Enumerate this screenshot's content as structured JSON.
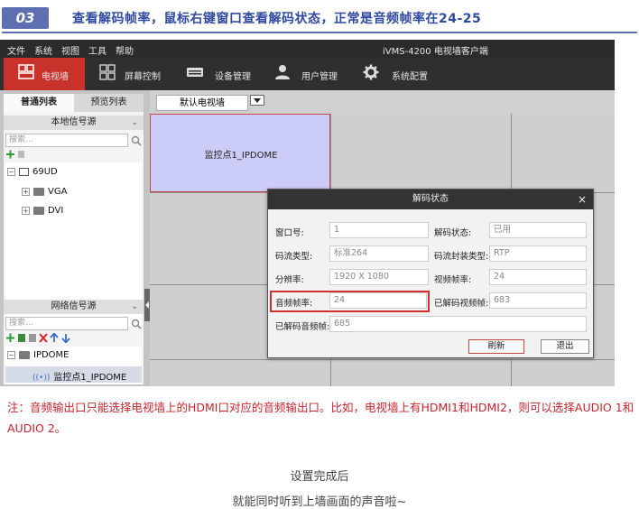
{
  "step": {
    "number": "03",
    "title": "查看解码帧率，鼠标右键窗口查看解码状态，正常是音频帧率在24-25",
    "accent": "#5d6fb0"
  },
  "app": {
    "window_title": "iVMS-4200 电视墙客户端",
    "menu": [
      "文件",
      "系统",
      "视图",
      "工具",
      "帮助"
    ],
    "toolbar": [
      {
        "label": "电视墙",
        "icon": "tv-wall-icon",
        "active": true
      },
      {
        "label": "屏幕控制",
        "icon": "screen-grid-icon",
        "active": false
      },
      {
        "label": "设备管理",
        "icon": "device-icon",
        "active": false
      },
      {
        "label": "用户管理",
        "icon": "user-icon",
        "active": false
      },
      {
        "label": "系统配置",
        "icon": "gear-icon",
        "active": false
      }
    ],
    "active_color": "#c8322b"
  },
  "left_panel": {
    "tabs": [
      "普通列表",
      "预览列表"
    ],
    "local_section": "本地信号源",
    "local_search_placeholder": "搜索...",
    "local_tree": [
      {
        "label": "69UD",
        "level": 0
      },
      {
        "label": "VGA",
        "level": 1
      },
      {
        "label": "DVI",
        "level": 1
      }
    ],
    "network_section": "网络信号源",
    "network_search_placeholder": "搜索...",
    "network_tree": [
      {
        "label": "IPDOME",
        "level": 0
      },
      {
        "label": "监控点1_IPDOME",
        "level": 1
      }
    ]
  },
  "wall": {
    "selected_wall": "默认电视墙",
    "selected_cell_label": "监控点1_IPDOME"
  },
  "dialog": {
    "title": "解码状态",
    "fields": {
      "window_no_label": "窗口号:",
      "window_no": "1",
      "decode_status_label": "解码状态:",
      "decode_status": "已用",
      "stream_type_label": "码流类型:",
      "stream_type": "标准264",
      "encap_type_label": "码流封装类型:",
      "encap_type": "RTP",
      "resolution_label": "分辨率:",
      "resolution": "1920 X 1080",
      "video_fps_label": "视频帧率:",
      "video_fps": "24",
      "audio_fps_label": "音频帧率:",
      "audio_fps": "24",
      "decoded_video_label": "已解码视频帧:",
      "decoded_video": "683",
      "decoded_audio_label": "已解码音频帧:",
      "decoded_audio": "685"
    },
    "refresh_label": "刷新",
    "exit_label": "退出"
  },
  "note": "注：音频输出口只能选择电视墙上的HDMI口对应的音频输出口。比如，电视墙上有HDMI1和HDMI2，则可以选择AUDIO 1和AUDIO 2。",
  "footer": {
    "line1": "设置完成后",
    "line2": "就能同时听到上墙画面的声音啦~"
  }
}
